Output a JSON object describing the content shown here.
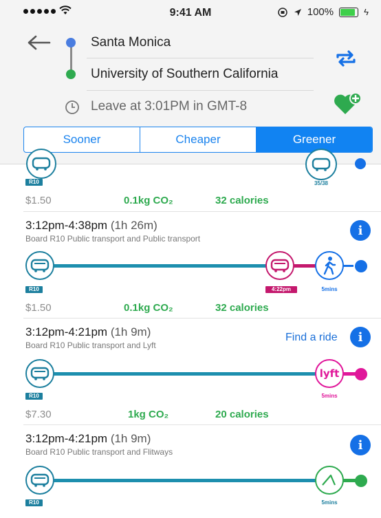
{
  "status_bar": {
    "time": "9:41 AM",
    "battery": "100%"
  },
  "header": {
    "origin": "Santa Monica",
    "destination": "University of Southern California",
    "leave_time": "Leave at 3:01PM in GMT-8",
    "tabs": [
      {
        "label": "Sooner",
        "active": false
      },
      {
        "label": "Cheaper",
        "active": false
      },
      {
        "label": "Greener",
        "active": true
      }
    ]
  },
  "routes": [
    {
      "bus_tag": "R10",
      "dest_tag": "35/38",
      "price": "$1.50",
      "co2": "0.1kg CO₂",
      "calories": "32 calories"
    },
    {
      "time_range": "3:12pm-4:38pm",
      "duration": "(1h 26m)",
      "description": "Board R10 Public transport and Public transport",
      "bus_tag": "R10",
      "transfer_tag": "4:22pm",
      "walk_tag": "5mins",
      "price": "$1.50",
      "co2": "0.1kg CO₂",
      "calories": "32 calories"
    },
    {
      "time_range": "3:12pm-4:21pm",
      "duration": "(1h 9m)",
      "description": "Board R10 Public transport and Lyft",
      "find_ride": "Find a ride",
      "bus_tag": "R10",
      "lyft_logo": "lyft",
      "lyft_tag": "5mins",
      "price": "$7.30",
      "co2": "1kg CO₂",
      "calories": "20 calories"
    },
    {
      "time_range": "3:12pm-4:21pm",
      "duration": "(1h 9m)",
      "description": "Board R10 Public transport and Flitways",
      "bus_tag": "R10",
      "flit_tag": "5mins"
    }
  ],
  "colors": {
    "accent": "#1183f2",
    "green": "#2eaa4f",
    "transit": "#1c7f9e",
    "bus_line": "#1d8fae",
    "magenta": "#c4186d",
    "lyft_pink": "#e0179a"
  },
  "icons": [
    "back-arrow-icon",
    "swap-icon",
    "favorite-add-icon",
    "clock-icon",
    "bus-icon",
    "walk-icon",
    "info-icon",
    "lyft-logo",
    "flitways-icon"
  ]
}
